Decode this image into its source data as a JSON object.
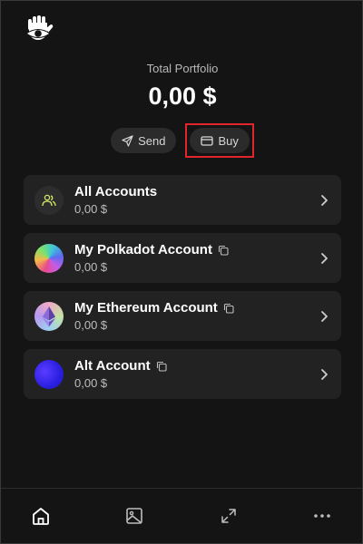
{
  "app": {
    "logo_icon": "hand-eye-logo-icon"
  },
  "portfolio": {
    "label": "Total Portfolio",
    "value": "0,00 $"
  },
  "actions": {
    "send_label": "Send",
    "buy_label": "Buy"
  },
  "accounts": [
    {
      "name": "All Accounts",
      "value": "0,00 $",
      "icon": "users-icon",
      "copyable": false
    },
    {
      "name": "My Polkadot Account",
      "value": "0,00 $",
      "icon": "polkadot-avatar",
      "copyable": true
    },
    {
      "name": "My Ethereum Account",
      "value": "0,00 $",
      "icon": "ethereum-avatar",
      "copyable": true
    },
    {
      "name": "Alt Account",
      "value": "0,00 $",
      "icon": "alt-avatar",
      "copyable": true
    }
  ],
  "tabs": [
    {
      "name": "home",
      "icon": "home-icon",
      "active": true
    },
    {
      "name": "nfts",
      "icon": "image-icon",
      "active": false
    },
    {
      "name": "expand",
      "icon": "expand-icon",
      "active": false
    },
    {
      "name": "more",
      "icon": "more-icon",
      "active": false
    }
  ],
  "colors": {
    "background": "#141414",
    "card": "#222222",
    "accent_highlight": "#e0262b",
    "all_accounts_icon": "#d5e86a"
  }
}
